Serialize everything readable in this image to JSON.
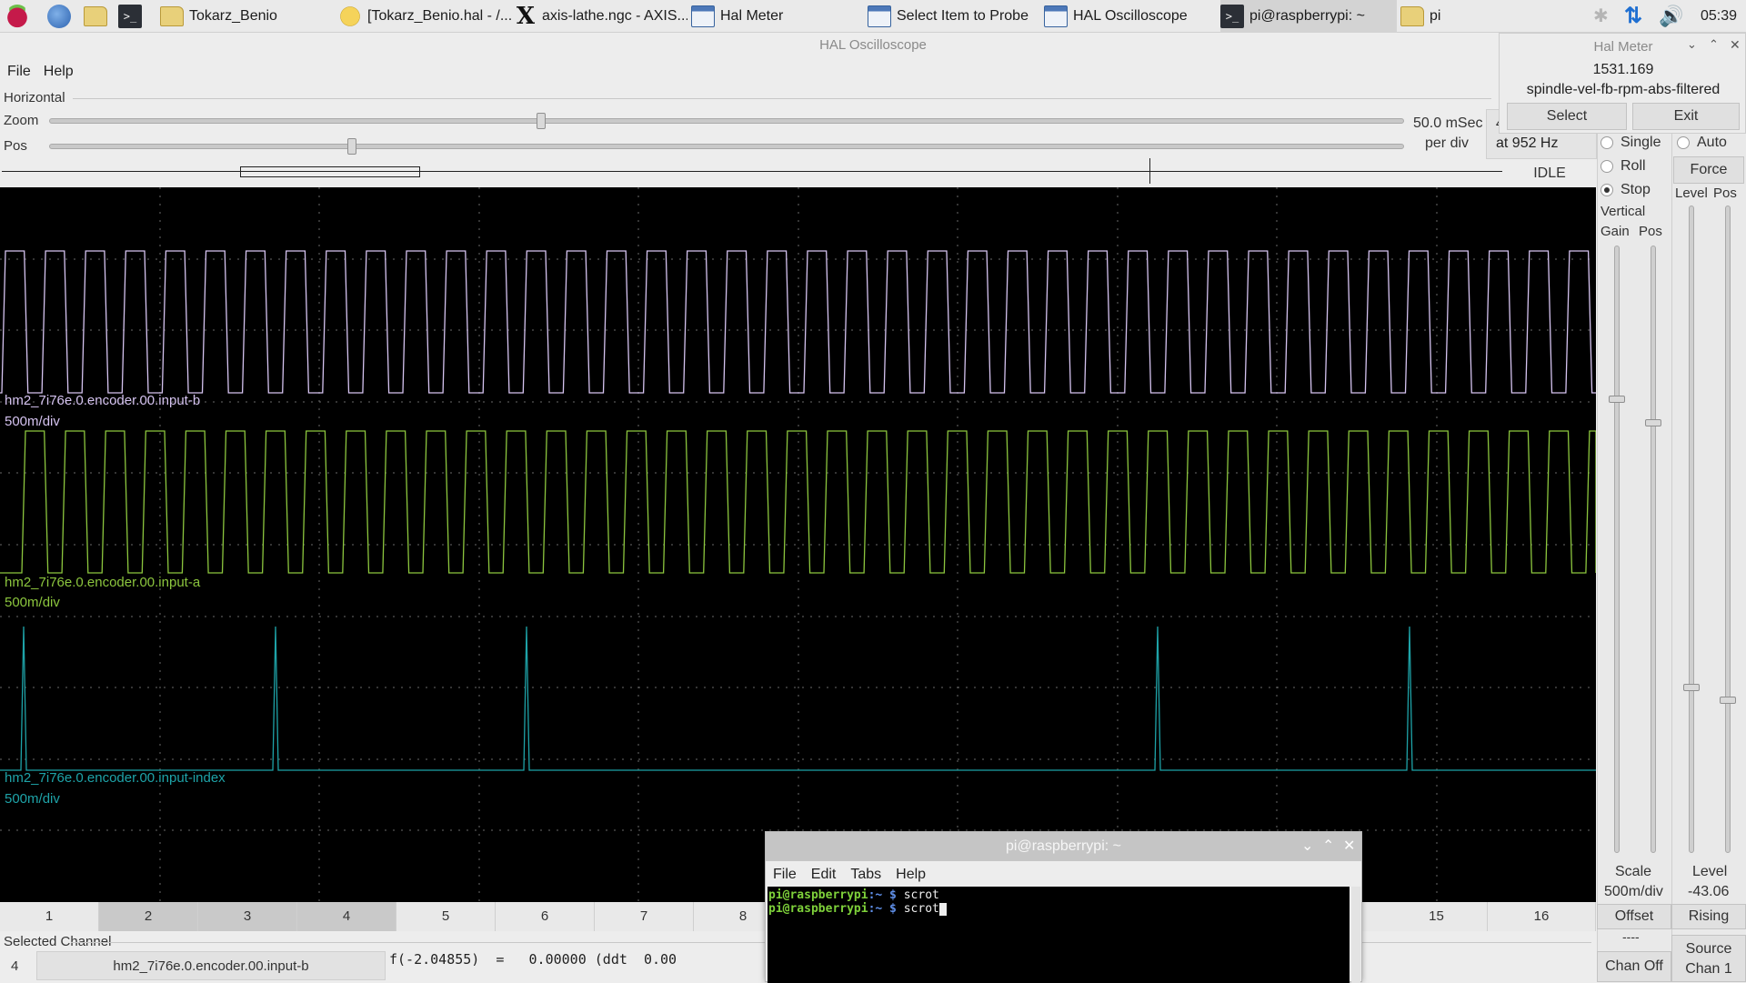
{
  "taskbar": {
    "items": [
      {
        "label": "Tokarz_Benio",
        "icon": "folder-icon"
      },
      {
        "label": "[Tokarz_Benio.hal - /...",
        "icon": "geany-icon"
      },
      {
        "label": "axis-lathe.ngc - AXIS...",
        "icon": "x-icon"
      },
      {
        "label": "Hal Meter",
        "icon": "window-icon"
      },
      {
        "label": "Select Item to Probe",
        "icon": "window-icon"
      },
      {
        "label": "HAL Oscilloscope",
        "icon": "window-icon"
      },
      {
        "label": "pi@raspberrypi: ~",
        "icon": "terminal-icon"
      },
      {
        "label": "pi",
        "icon": "folder-icon"
      }
    ],
    "clock": "05:39"
  },
  "window": {
    "title": "HAL Oscilloscope"
  },
  "menu": {
    "file": "File",
    "help": "Help"
  },
  "horizontal": {
    "group_label": "Horizontal",
    "zoom_label": "Zoom",
    "pos_label": "Pos",
    "zoom_value": "50.0 mSec",
    "per_div": "per div",
    "rate": "at 952 Hz",
    "rate_prefix": "4",
    "status": "IDLE",
    "zoom_fraction": 0.36,
    "pos_fraction": 0.22
  },
  "run_mode": {
    "single": "Single",
    "roll": "Roll",
    "stop": "Stop",
    "selected": "Stop"
  },
  "trigger": {
    "auto": "Auto",
    "force": "Force",
    "level_label": "Level",
    "pos_label": "Pos",
    "level_readout_label": "Level",
    "level_value": "-43.06",
    "edge": "Rising",
    "source_label": "Source",
    "source_value": "Chan  1"
  },
  "vertical": {
    "group_label": "Vertical",
    "gain_label": "Gain",
    "pos_label": "Pos",
    "scale_label": "Scale",
    "scale_value": "500m/div",
    "offset_label": "Offset",
    "offset_value": "----",
    "chan_off": "Chan Off"
  },
  "traces": [
    {
      "name": "hm2_7i76e.0.encoder.00.input-b",
      "scale": "500m/div",
      "color": "#d5c3f0"
    },
    {
      "name": "hm2_7i76e.0.encoder.00.input-a",
      "scale": "500m/div",
      "color": "#8cc63e"
    },
    {
      "name": "hm2_7i76e.0.encoder.00.input-index",
      "scale": "500m/div",
      "color": "#1ea3a8"
    }
  ],
  "channels": [
    "1",
    "2",
    "3",
    "4",
    "5",
    "6",
    "7",
    "8",
    "15",
    "16"
  ],
  "selected_channel": {
    "label": "Selected Channel",
    "number": "4",
    "name": "hm2_7i76e.0.encoder.00.input-b",
    "readout": "f(-2.04855)  =   0.00000 (ddt  0.00"
  },
  "hal_meter": {
    "title": "Hal Meter",
    "value": "1531.169",
    "signal": "spindle-vel-fb-rpm-abs-filtered",
    "select": "Select",
    "exit": "Exit"
  },
  "terminal": {
    "title": "pi@raspberrypi: ~",
    "menu": [
      "File",
      "Edit",
      "Tabs",
      "Help"
    ],
    "lines": [
      {
        "user": "pi@raspberrypi",
        "path": ":~ $",
        "cmd": " scrot"
      },
      {
        "user": "pi@raspberrypi",
        "path": ":~ $",
        "cmd": " scrot"
      }
    ]
  }
}
